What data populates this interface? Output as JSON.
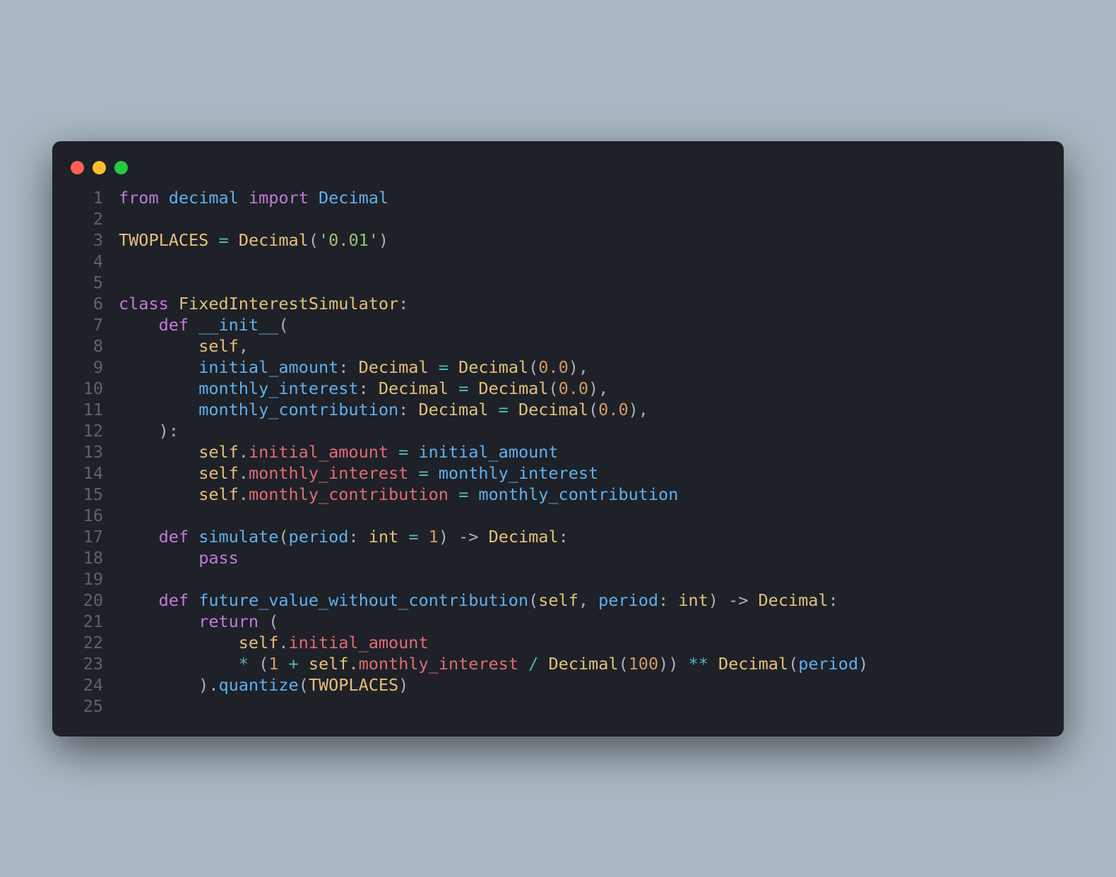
{
  "window": {
    "traffic_lights": [
      "red",
      "yellow",
      "green"
    ]
  },
  "code": {
    "lines": [
      {
        "n": "1",
        "tokens": [
          [
            "kw",
            "from"
          ],
          [
            "pn",
            " "
          ],
          [
            "fn",
            "decimal"
          ],
          [
            "pn",
            " "
          ],
          [
            "kw",
            "import"
          ],
          [
            "pn",
            " "
          ],
          [
            "fn",
            "Decimal"
          ]
        ]
      },
      {
        "n": "2",
        "tokens": []
      },
      {
        "n": "3",
        "tokens": [
          [
            "const",
            "TWOPLACES"
          ],
          [
            "pn",
            " "
          ],
          [
            "op",
            "="
          ],
          [
            "pn",
            " "
          ],
          [
            "cls",
            "Decimal"
          ],
          [
            "pn",
            "("
          ],
          [
            "str",
            "'0.01'"
          ],
          [
            "pn",
            ")"
          ]
        ]
      },
      {
        "n": "4",
        "tokens": []
      },
      {
        "n": "5",
        "tokens": []
      },
      {
        "n": "6",
        "tokens": [
          [
            "kw",
            "class"
          ],
          [
            "pn",
            " "
          ],
          [
            "cls",
            "FixedInterestSimulator"
          ],
          [
            "pn",
            ":"
          ]
        ]
      },
      {
        "n": "7",
        "tokens": [
          [
            "pn",
            "    "
          ],
          [
            "kw",
            "def"
          ],
          [
            "pn",
            " "
          ],
          [
            "fn",
            "__init__"
          ],
          [
            "pn",
            "("
          ]
        ]
      },
      {
        "n": "8",
        "tokens": [
          [
            "pn",
            "        "
          ],
          [
            "prm",
            "self"
          ],
          [
            "pn",
            ","
          ]
        ]
      },
      {
        "n": "9",
        "tokens": [
          [
            "pn",
            "        "
          ],
          [
            "fn",
            "initial_amount"
          ],
          [
            "pn",
            ": "
          ],
          [
            "cls",
            "Decimal"
          ],
          [
            "pn",
            " "
          ],
          [
            "op",
            "="
          ],
          [
            "pn",
            " "
          ],
          [
            "cls",
            "Decimal"
          ],
          [
            "pn",
            "("
          ],
          [
            "num",
            "0.0"
          ],
          [
            "pn",
            "),"
          ]
        ]
      },
      {
        "n": "10",
        "tokens": [
          [
            "pn",
            "        "
          ],
          [
            "fn",
            "monthly_interest"
          ],
          [
            "pn",
            ": "
          ],
          [
            "cls",
            "Decimal"
          ],
          [
            "pn",
            " "
          ],
          [
            "op",
            "="
          ],
          [
            "pn",
            " "
          ],
          [
            "cls",
            "Decimal"
          ],
          [
            "pn",
            "("
          ],
          [
            "num",
            "0.0"
          ],
          [
            "pn",
            "),"
          ]
        ]
      },
      {
        "n": "11",
        "tokens": [
          [
            "pn",
            "        "
          ],
          [
            "fn",
            "monthly_contribution"
          ],
          [
            "pn",
            ": "
          ],
          [
            "cls",
            "Decimal"
          ],
          [
            "pn",
            " "
          ],
          [
            "op",
            "="
          ],
          [
            "pn",
            " "
          ],
          [
            "cls",
            "Decimal"
          ],
          [
            "pn",
            "("
          ],
          [
            "num",
            "0.0"
          ],
          [
            "pn",
            "),"
          ]
        ]
      },
      {
        "n": "12",
        "tokens": [
          [
            "pn",
            "    ):"
          ]
        ]
      },
      {
        "n": "13",
        "tokens": [
          [
            "pn",
            "        "
          ],
          [
            "prm",
            "self"
          ],
          [
            "pn",
            "."
          ],
          [
            "id",
            "initial_amount"
          ],
          [
            "pn",
            " "
          ],
          [
            "op",
            "="
          ],
          [
            "pn",
            " "
          ],
          [
            "fn",
            "initial_amount"
          ]
        ]
      },
      {
        "n": "14",
        "tokens": [
          [
            "pn",
            "        "
          ],
          [
            "prm",
            "self"
          ],
          [
            "pn",
            "."
          ],
          [
            "id",
            "monthly_interest"
          ],
          [
            "pn",
            " "
          ],
          [
            "op",
            "="
          ],
          [
            "pn",
            " "
          ],
          [
            "fn",
            "monthly_interest"
          ]
        ]
      },
      {
        "n": "15",
        "tokens": [
          [
            "pn",
            "        "
          ],
          [
            "prm",
            "self"
          ],
          [
            "pn",
            "."
          ],
          [
            "id",
            "monthly_contribution"
          ],
          [
            "pn",
            " "
          ],
          [
            "op",
            "="
          ],
          [
            "pn",
            " "
          ],
          [
            "fn",
            "monthly_contribution"
          ]
        ]
      },
      {
        "n": "16",
        "tokens": []
      },
      {
        "n": "17",
        "tokens": [
          [
            "pn",
            "    "
          ],
          [
            "kw",
            "def"
          ],
          [
            "pn",
            " "
          ],
          [
            "fn",
            "simulate"
          ],
          [
            "pn",
            "("
          ],
          [
            "fn",
            "period"
          ],
          [
            "pn",
            ": "
          ],
          [
            "cls",
            "int"
          ],
          [
            "pn",
            " "
          ],
          [
            "op",
            "="
          ],
          [
            "pn",
            " "
          ],
          [
            "num",
            "1"
          ],
          [
            "pn",
            ") -> "
          ],
          [
            "cls",
            "Decimal"
          ],
          [
            "pn",
            ":"
          ]
        ]
      },
      {
        "n": "18",
        "tokens": [
          [
            "pn",
            "        "
          ],
          [
            "kw",
            "pass"
          ]
        ]
      },
      {
        "n": "19",
        "tokens": []
      },
      {
        "n": "20",
        "tokens": [
          [
            "pn",
            "    "
          ],
          [
            "kw",
            "def"
          ],
          [
            "pn",
            " "
          ],
          [
            "fn",
            "future_value_without_contribution"
          ],
          [
            "pn",
            "("
          ],
          [
            "prm",
            "self"
          ],
          [
            "pn",
            ", "
          ],
          [
            "fn",
            "period"
          ],
          [
            "pn",
            ": "
          ],
          [
            "cls",
            "int"
          ],
          [
            "pn",
            ") -> "
          ],
          [
            "cls",
            "Decimal"
          ],
          [
            "pn",
            ":"
          ]
        ]
      },
      {
        "n": "21",
        "tokens": [
          [
            "pn",
            "        "
          ],
          [
            "kw",
            "return"
          ],
          [
            "pn",
            " ("
          ]
        ]
      },
      {
        "n": "22",
        "tokens": [
          [
            "pn",
            "            "
          ],
          [
            "prm",
            "self"
          ],
          [
            "pn",
            "."
          ],
          [
            "id",
            "initial_amount"
          ]
        ]
      },
      {
        "n": "23",
        "tokens": [
          [
            "pn",
            "            "
          ],
          [
            "op",
            "*"
          ],
          [
            "pn",
            " ("
          ],
          [
            "num",
            "1"
          ],
          [
            "pn",
            " "
          ],
          [
            "op",
            "+"
          ],
          [
            "pn",
            " "
          ],
          [
            "prm",
            "self"
          ],
          [
            "pn",
            "."
          ],
          [
            "id",
            "monthly_interest"
          ],
          [
            "pn",
            " "
          ],
          [
            "op",
            "/"
          ],
          [
            "pn",
            " "
          ],
          [
            "cls",
            "Decimal"
          ],
          [
            "pn",
            "("
          ],
          [
            "num",
            "100"
          ],
          [
            "pn",
            ")) "
          ],
          [
            "op",
            "**"
          ],
          [
            "pn",
            " "
          ],
          [
            "cls",
            "Decimal"
          ],
          [
            "pn",
            "("
          ],
          [
            "fn",
            "period"
          ],
          [
            "pn",
            ")"
          ]
        ]
      },
      {
        "n": "24",
        "tokens": [
          [
            "pn",
            "        )."
          ],
          [
            "fn",
            "quantize"
          ],
          [
            "pn",
            "("
          ],
          [
            "const",
            "TWOPLACES"
          ],
          [
            "pn",
            ")"
          ]
        ]
      },
      {
        "n": "25",
        "tokens": []
      }
    ]
  }
}
